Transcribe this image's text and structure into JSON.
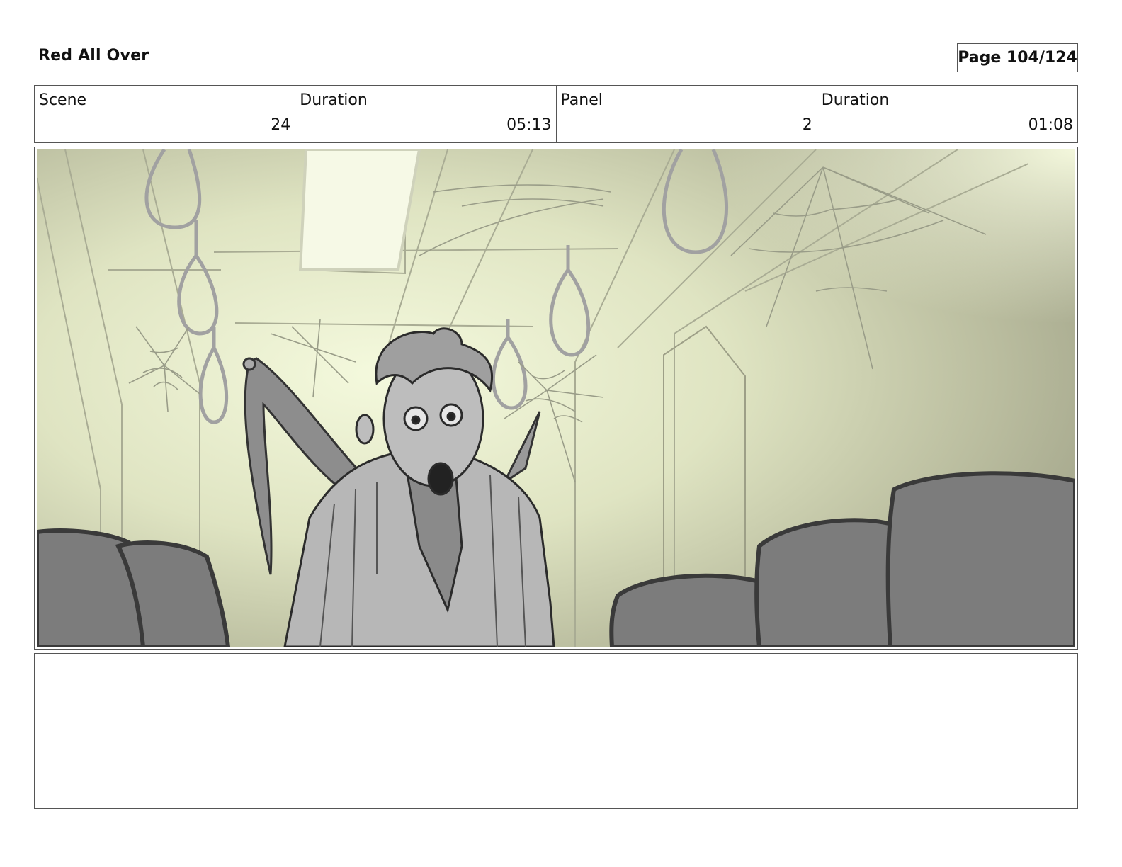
{
  "header": {
    "title": "Red All Over",
    "page": "Page 104/124"
  },
  "info": {
    "scene_label": "Scene",
    "scene_value": "24",
    "scene_duration_label": "Duration",
    "scene_duration_value": "05:13",
    "panel_label": "Panel",
    "panel_value": "2",
    "panel_duration_label": "Duration",
    "panel_duration_value": "01:08"
  },
  "notes": {
    "text": ""
  },
  "colors": {
    "border": "#555555",
    "background_glow": "#f3f8dc",
    "background_dark": "#9a9c84",
    "seat_fill": "#7c7c7c"
  }
}
